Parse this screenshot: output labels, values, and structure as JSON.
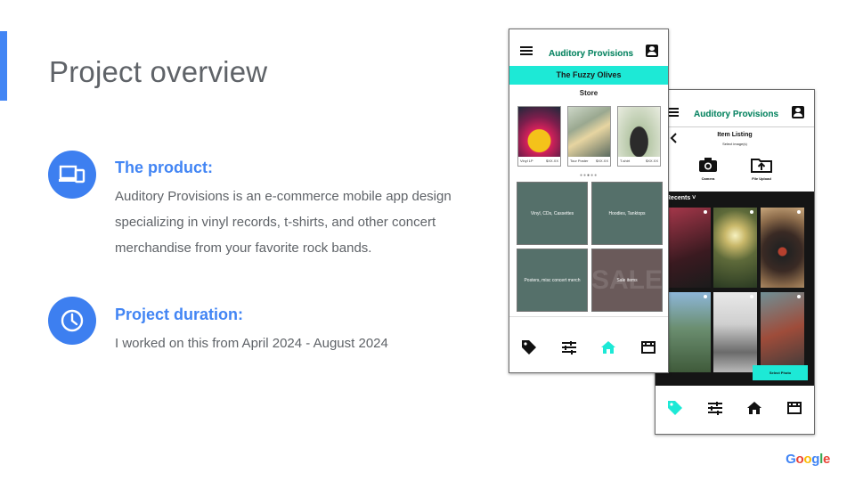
{
  "slide": {
    "title": "Project overview"
  },
  "product": {
    "heading": "The product:",
    "body": "Auditory Provisions is an e-commerce mobile app design specializing in vinyl records, t-shirts, and other concert merchandise from your favorite rock bands.",
    "icon": "devices-icon"
  },
  "duration": {
    "heading": "Project duration:",
    "body": "I worked on this from April 2024 - August 2024",
    "icon": "clock-icon"
  },
  "footer": {
    "logo_letters": [
      "G",
      "o",
      "o",
      "g",
      "l",
      "e"
    ],
    "logo_colors": [
      "#4285f4",
      "#ea4335",
      "#fbbc05",
      "#4285f4",
      "#34a853",
      "#ea4335"
    ]
  },
  "phone_front": {
    "app_title": "Auditory Provisions",
    "band_name": "The Fuzzy Olives",
    "section": "Store",
    "products": [
      {
        "name": "Vinyl LP",
        "price": "$XX.XX"
      },
      {
        "name": "Tour Poster",
        "price": "$XX.XX"
      },
      {
        "name": "T-shirt",
        "price": "$XX.XX"
      }
    ],
    "tiles": [
      "Vinyl, CDs, Cassettes",
      "Hoodies, Tanktops",
      "Posters, misc concert merch",
      "Sale items"
    ],
    "sale_watermark": "SALE"
  },
  "phone_back": {
    "app_title": "Auditory Provisions",
    "screen_title": "Item Listing",
    "screen_subtitle": "Select image(s)",
    "camera_label": "Camera",
    "upload_label": "File Upload",
    "recents_label": "Recents",
    "select_button": "Select Photo"
  },
  "colors": {
    "accent_blue": "#4285f4",
    "brand_teal": "#1de9d6",
    "app_title_green": "#15846e"
  }
}
